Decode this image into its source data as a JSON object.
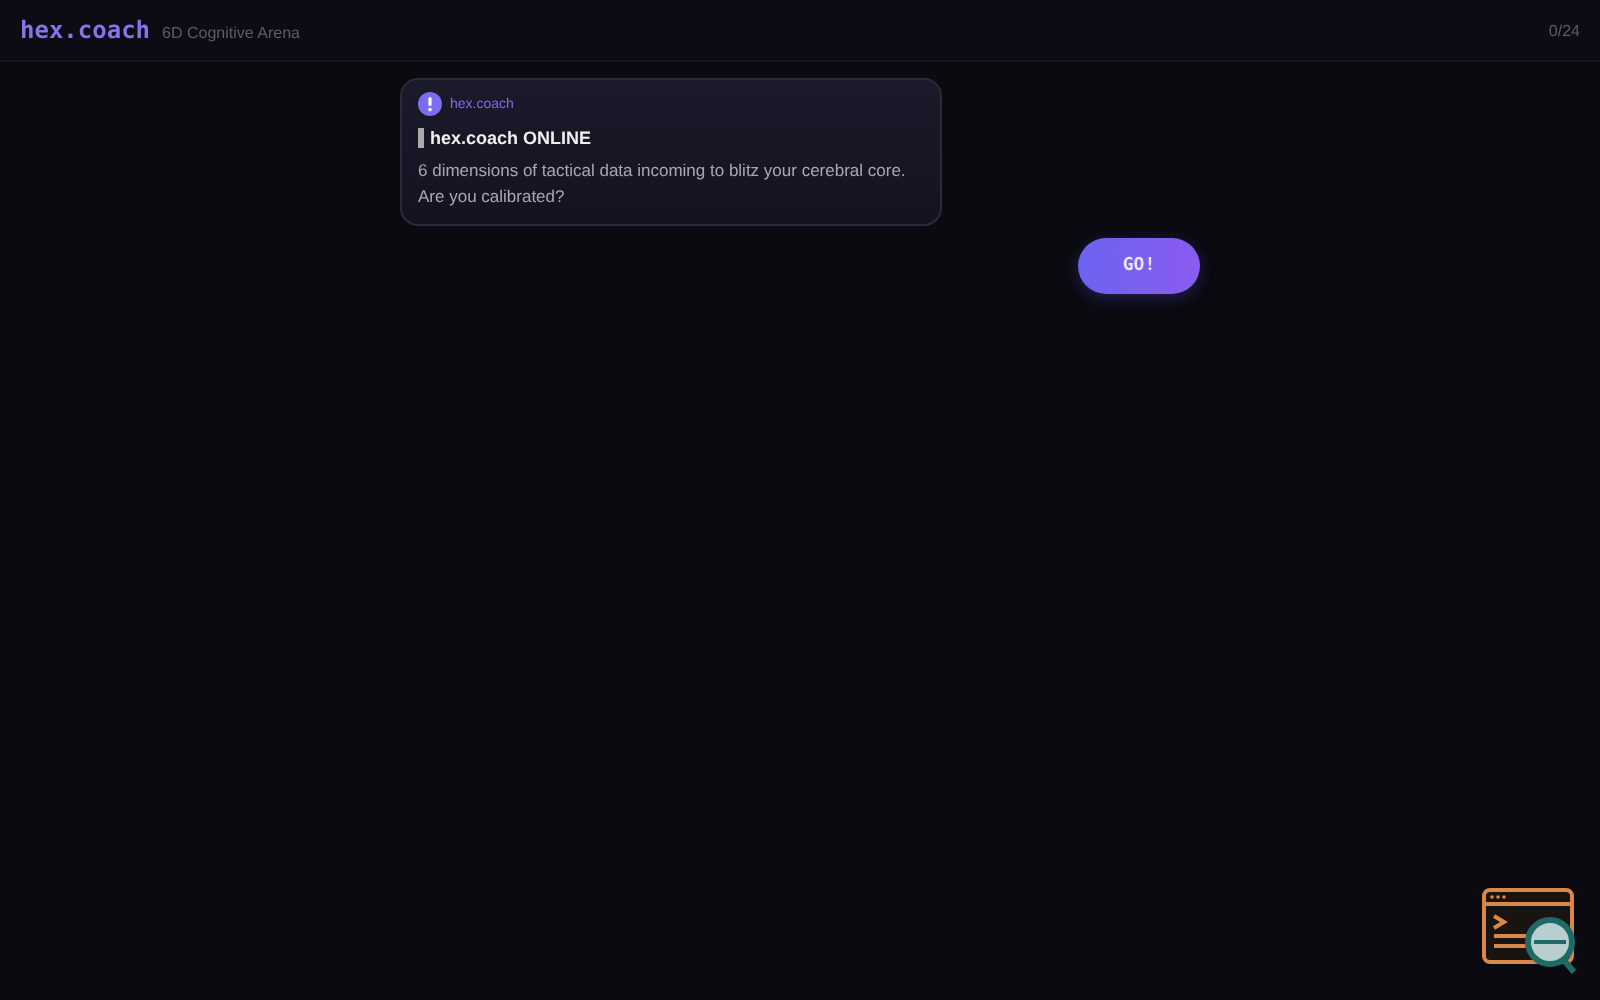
{
  "header": {
    "logo": "hex.coach",
    "subtitle": "6D Cognitive Arena",
    "progress": "0/24"
  },
  "message": {
    "sender": "hex.coach",
    "title": "hex.coach ONLINE",
    "body": "6 dimensions of tactical data incoming to blitz your cerebral core. Are you calibrated?"
  },
  "reply_button": "GO!"
}
